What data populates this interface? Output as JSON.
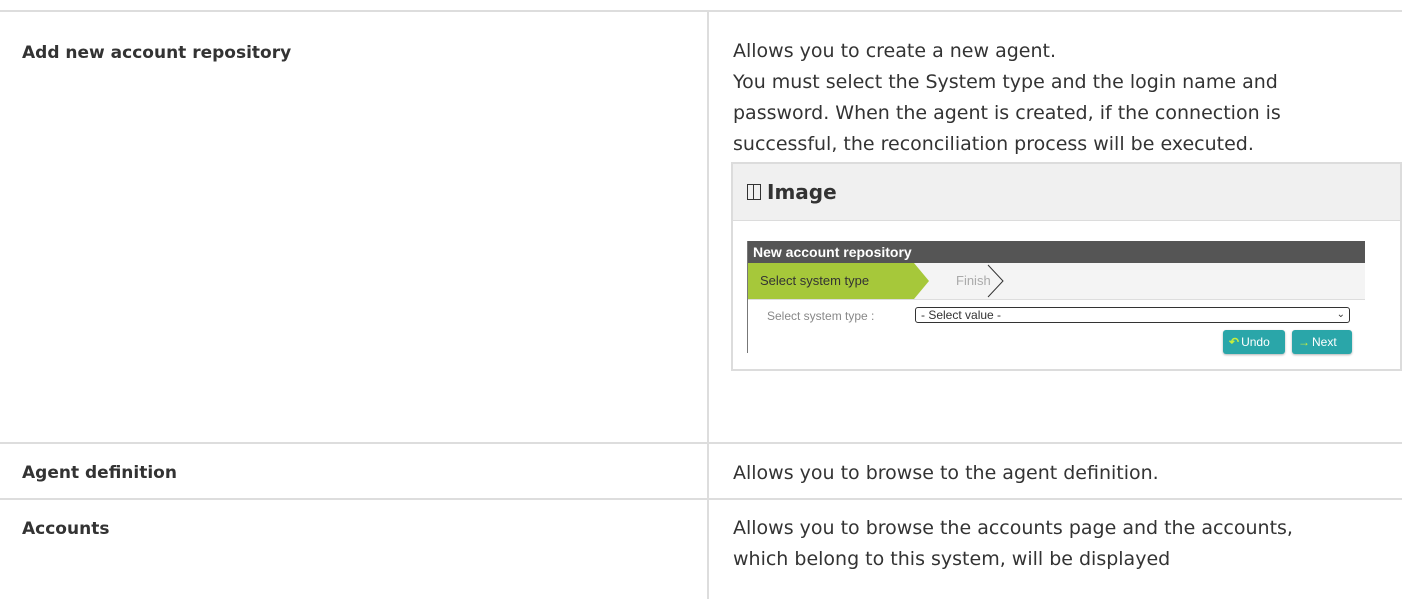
{
  "rows": [
    {
      "term": "Add new account repository",
      "description": [
        "Allows you to create a new agent.",
        "You must select the System type and the login name and",
        "password. When the agent is created, if the connection is",
        "successful, the reconciliation process will be executed."
      ],
      "expander": {
        "title": "Image",
        "icon": "book-icon",
        "screenshot": {
          "window_title": "New account repository",
          "steps": [
            "Select system type",
            "Finish"
          ],
          "field_label": "Select system type :",
          "select_value": "- Select value -",
          "buttons": {
            "undo": "Undo",
            "next": "Next"
          },
          "colors": {
            "active_step": "#a6c83a",
            "button": "#2aa6a9",
            "title_bar": "#555555"
          }
        }
      }
    },
    {
      "term": "Agent definition",
      "description": [
        "Allows you to browse to the agent definition."
      ]
    },
    {
      "term": "Accounts",
      "description": [
        "Allows you to browse the accounts page and the accounts,",
        "which belong to this system, will be displayed"
      ]
    }
  ]
}
